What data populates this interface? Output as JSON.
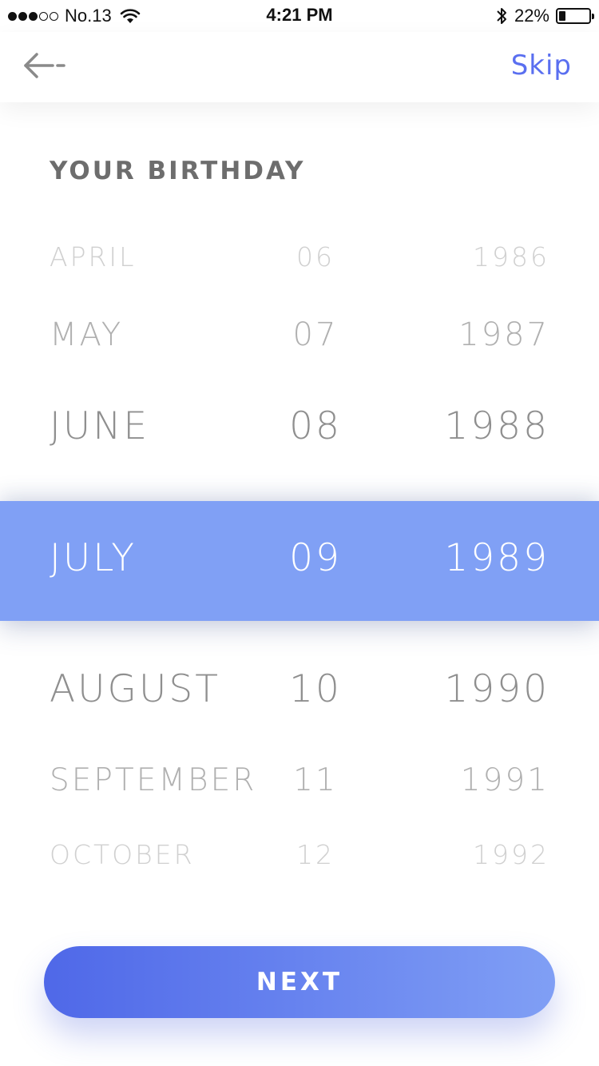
{
  "status_bar": {
    "carrier": "No.13",
    "time": "4:21 PM",
    "battery_percent": "22%",
    "battery_level": 0.22,
    "signal_bars_filled": 3,
    "signal_bars_total": 5
  },
  "nav": {
    "back_icon": "back-arrow-icon",
    "skip_label": "Skip"
  },
  "title": "YOUR BIRTHDAY",
  "picker": {
    "rows": [
      {
        "month": "APRIL",
        "day": "06",
        "year": "1986"
      },
      {
        "month": "MAY",
        "day": "07",
        "year": "1987"
      },
      {
        "month": "JUNE",
        "day": "08",
        "year": "1988"
      },
      {
        "month": "JULY",
        "day": "09",
        "year": "1989",
        "selected": true
      },
      {
        "month": "AUGUST",
        "day": "10",
        "year": "1990"
      },
      {
        "month": "SEPTEMBER",
        "day": "11",
        "year": "1991"
      },
      {
        "month": "OCTOBER",
        "day": "12",
        "year": "1992"
      }
    ]
  },
  "next_label": "NEXT",
  "colors": {
    "accent": "#5a6ff0",
    "selected_row": "#80a0f5",
    "button_gradient_start": "#4f68e8",
    "button_gradient_end": "#809ff5"
  }
}
